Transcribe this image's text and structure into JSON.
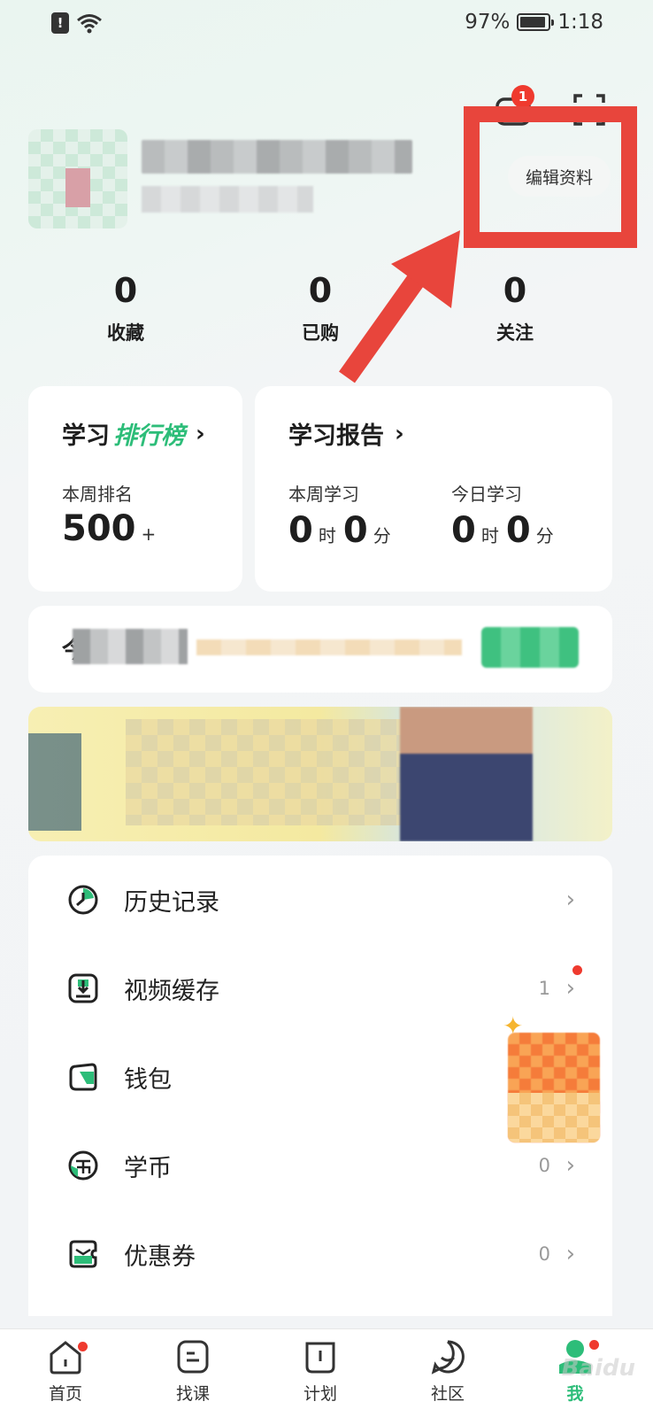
{
  "status_bar": {
    "battery": "97%",
    "time": "1:18",
    "alert": "!"
  },
  "header": {
    "message_badge": "1",
    "edit_profile": "编辑资料"
  },
  "stats": [
    {
      "value": "0",
      "label": "收藏"
    },
    {
      "value": "0",
      "label": "已购"
    },
    {
      "value": "0",
      "label": "关注"
    }
  ],
  "rank_card": {
    "title_a": "学习",
    "title_b": "排行榜",
    "week_label": "本周排名",
    "rank_value": "500",
    "rank_suffix": "+"
  },
  "report_card": {
    "title": "学习报告",
    "week_label": "本周学习",
    "today_label": "今日学习",
    "week_hours": "0",
    "week_minutes": "0",
    "today_hours": "0",
    "today_minutes": "0",
    "hour_unit": "时",
    "minute_unit": "分"
  },
  "promo": {
    "lead": "今"
  },
  "menu": [
    {
      "label": "历史记录",
      "icon": "clock-icon",
      "meta": ""
    },
    {
      "label": "视频缓存",
      "icon": "download-icon",
      "meta": "1"
    },
    {
      "label": "钱包",
      "icon": "wallet-icon",
      "meta": ""
    },
    {
      "label": "学币",
      "icon": "coin-icon",
      "meta": "0"
    },
    {
      "label": "优惠券",
      "icon": "coupon-icon",
      "meta": "0"
    }
  ],
  "tabs": [
    {
      "label": "首页",
      "icon": "home-icon"
    },
    {
      "label": "找课",
      "icon": "find-course-icon"
    },
    {
      "label": "计划",
      "icon": "plan-icon"
    },
    {
      "label": "社区",
      "icon": "community-icon"
    },
    {
      "label": "我",
      "icon": "me-icon"
    }
  ],
  "watermark": "Baidu",
  "colors": {
    "accent": "#2dbd79",
    "highlight": "#e8453c",
    "badge": "#ef3a2e"
  }
}
